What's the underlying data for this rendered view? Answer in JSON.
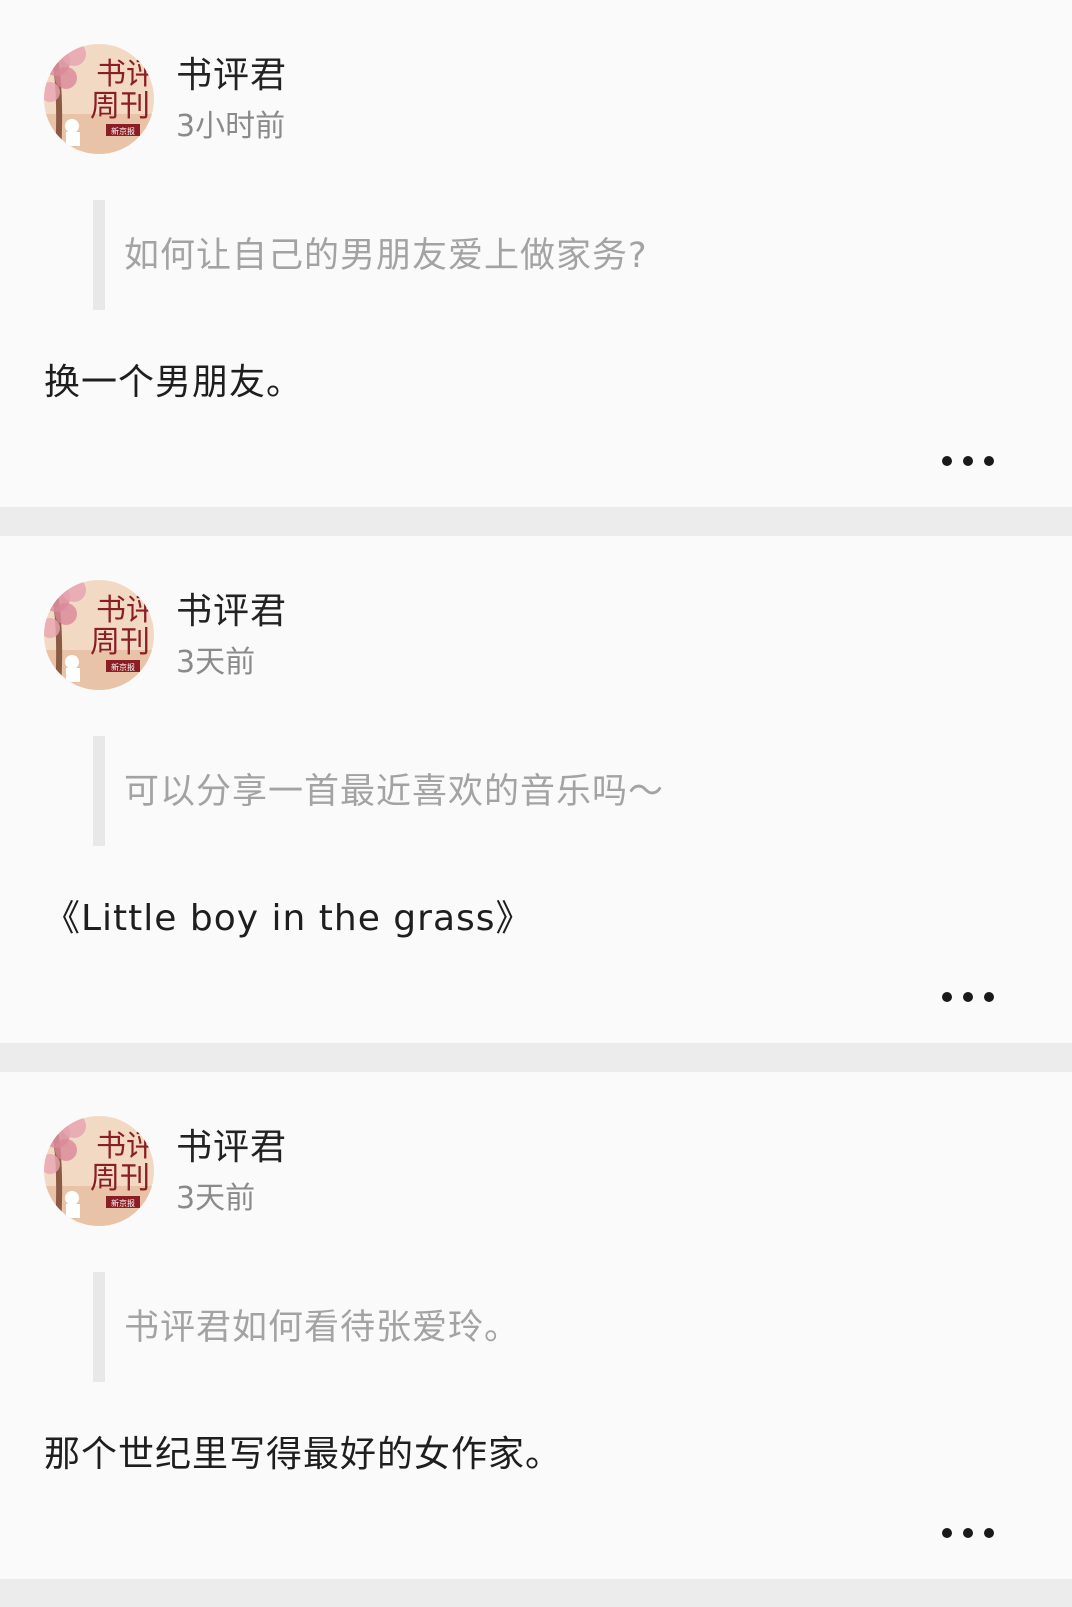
{
  "posts": [
    {
      "author": "书评君",
      "time": "3小时前",
      "question": "如何让自己的男朋友爱上做家务?",
      "answer": "换一个男朋友。",
      "avatar_text": [
        "书评",
        "周刊",
        "新京报"
      ],
      "more_icon": "more-dots-icon"
    },
    {
      "author": "书评君",
      "time": "3天前",
      "question": "可以分享一首最近喜欢的音乐吗～",
      "answer": "《Little boy in the grass》",
      "avatar_text": [
        "书评",
        "周刊",
        "新京报"
      ],
      "more_icon": "more-dots-icon"
    },
    {
      "author": "书评君",
      "time": "3天前",
      "question": "书评君如何看待张爱玲。",
      "answer": "那个世纪里写得最好的女作家。",
      "avatar_text": [
        "书评",
        "周刊",
        "新京报"
      ],
      "more_icon": "more-dots-icon"
    }
  ],
  "colors": {
    "card_background": "#fafafa",
    "separator": "#ececec",
    "question_text": "#a3a3a3",
    "timestamp_text": "#8a8a8a",
    "avatar_background": "#f2d9c4",
    "avatar_blossom": "#d9879a",
    "avatar_title": "#8b1e24"
  }
}
